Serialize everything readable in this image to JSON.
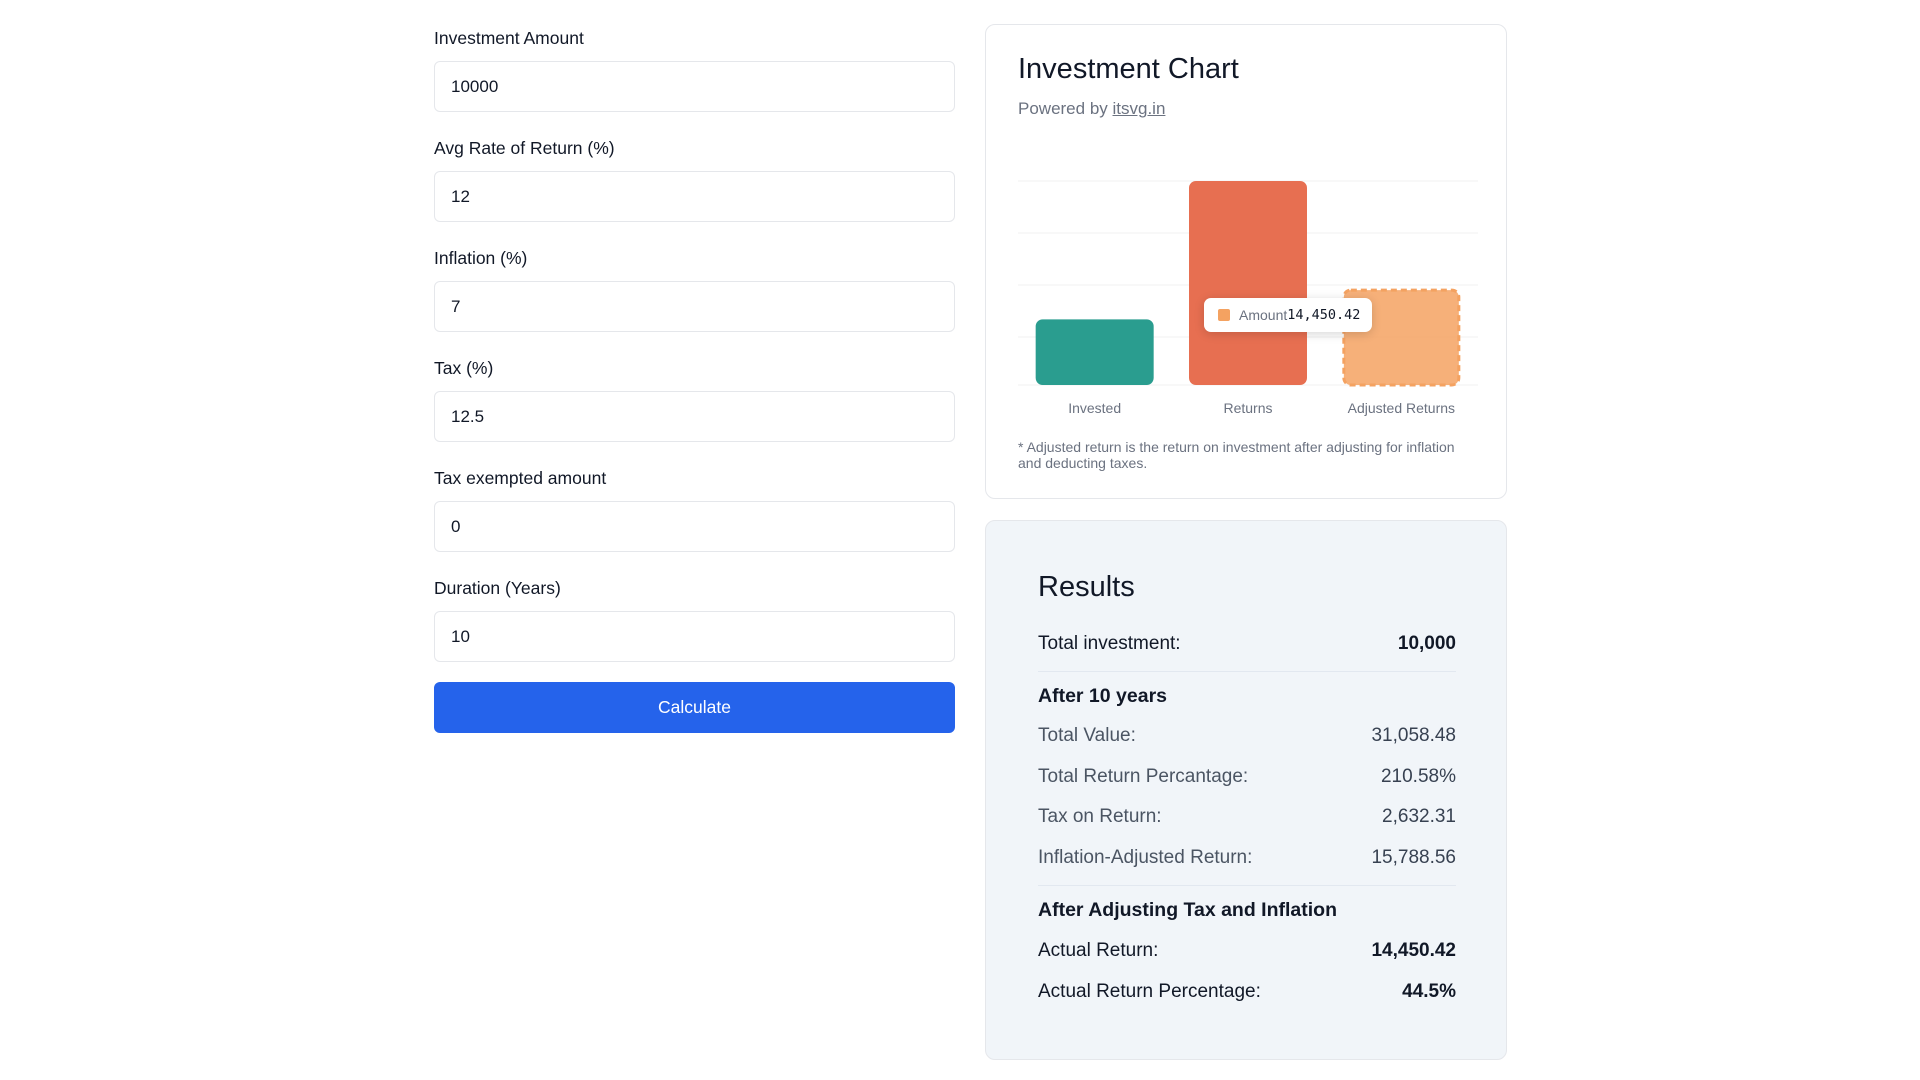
{
  "form": {
    "fields": [
      {
        "label": "Investment Amount",
        "value": "10000"
      },
      {
        "label": "Avg Rate of Return (%)",
        "value": "12"
      },
      {
        "label": "Inflation (%)",
        "value": "7"
      },
      {
        "label": "Tax (%)",
        "value": "12.5"
      },
      {
        "label": "Tax exempted amount",
        "value": "0"
      },
      {
        "label": "Duration (Years)",
        "value": "10"
      }
    ],
    "calculate_label": "Calculate"
  },
  "chart_card": {
    "title": "Investment Chart",
    "powered_by_prefix": "Powered by ",
    "powered_by_link": "itsvg.in",
    "note": "* Adjusted return is the return on investment after adjusting for inflation and deducting taxes.",
    "tooltip": {
      "label": "Amount",
      "value": "14,450.42"
    }
  },
  "chart_data": {
    "type": "bar",
    "categories": [
      "Invested",
      "Returns",
      "Adjusted Returns"
    ],
    "values": [
      10000,
      31058.48,
      14450.42
    ],
    "colors": [
      "#2a9d8f",
      "#e76f51",
      "#f4a261"
    ],
    "highlighted": "Adjusted Returns",
    "grid": true,
    "title": "",
    "xlabel": "",
    "ylabel": ""
  },
  "results": {
    "title": "Results",
    "total_investment_label": "Total investment:",
    "total_investment_value": "10,000",
    "after_heading": "After 10 years",
    "rows": [
      {
        "label": "Total Value:",
        "value": "31,058.48"
      },
      {
        "label": "Total Return Percantage:",
        "value": "210.58%"
      },
      {
        "label": "Tax on Return:",
        "value": "2,632.31"
      },
      {
        "label": "Inflation-Adjusted Return:",
        "value": "15,788.56"
      }
    ],
    "adjusted_heading": "After Adjusting Tax and Inflation",
    "actual_rows": [
      {
        "label": "Actual Return:",
        "value": "14,450.42"
      },
      {
        "label": "Actual Return Percentage:",
        "value": "44.5%"
      }
    ]
  }
}
